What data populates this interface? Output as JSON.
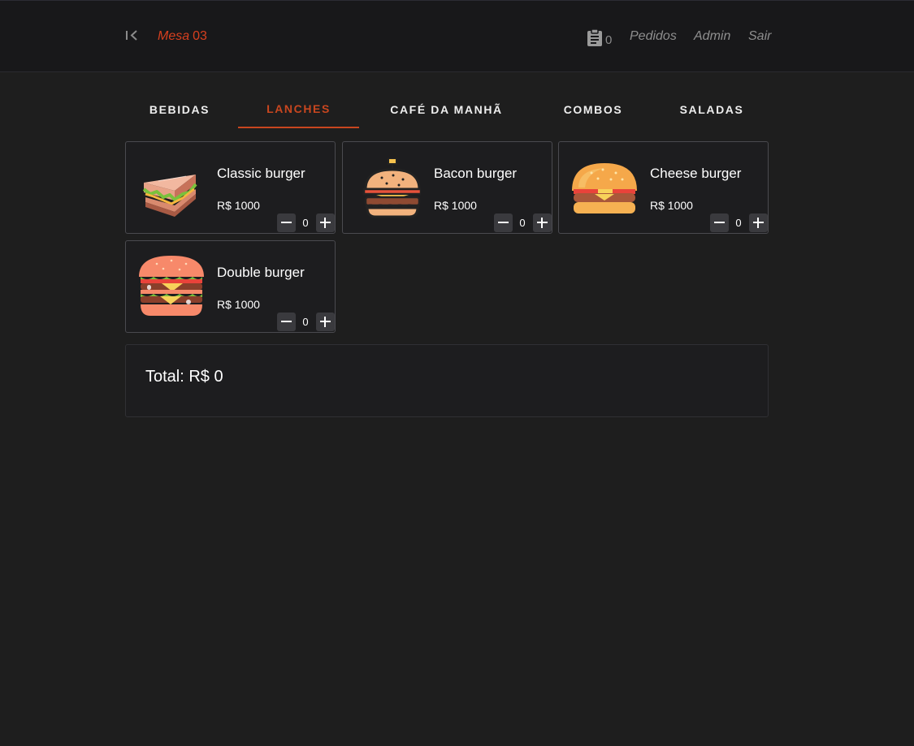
{
  "header": {
    "mesa_label": "Mesa",
    "mesa_number": "03",
    "orders_count": "0",
    "nav": [
      "Pedidos",
      "Admin",
      "Sair"
    ]
  },
  "tabs": [
    {
      "label": "BEBIDAS",
      "active": false
    },
    {
      "label": "LANCHES",
      "active": true
    },
    {
      "label": "CAFÉ DA MANHÃ",
      "active": false
    },
    {
      "label": "COMBOS",
      "active": false
    },
    {
      "label": "SALADAS",
      "active": false
    }
  ],
  "products": [
    {
      "name": "Classic burger",
      "price": "R$ 1000",
      "qty": "0",
      "icon": "sandwich-icon"
    },
    {
      "name": "Bacon burger",
      "price": "R$ 1000",
      "qty": "0",
      "icon": "bacon-burger-icon"
    },
    {
      "name": "Cheese burger",
      "price": "R$ 1000",
      "qty": "0",
      "icon": "cheese-burger-icon"
    },
    {
      "name": "Double burger",
      "price": "R$ 1000",
      "qty": "0",
      "icon": "double-burger-icon"
    }
  ],
  "total": {
    "label": "Total: R$ 0"
  },
  "colors": {
    "accent": "#c8461f",
    "background": "#1e1e1e",
    "header_bg": "#18181a"
  }
}
